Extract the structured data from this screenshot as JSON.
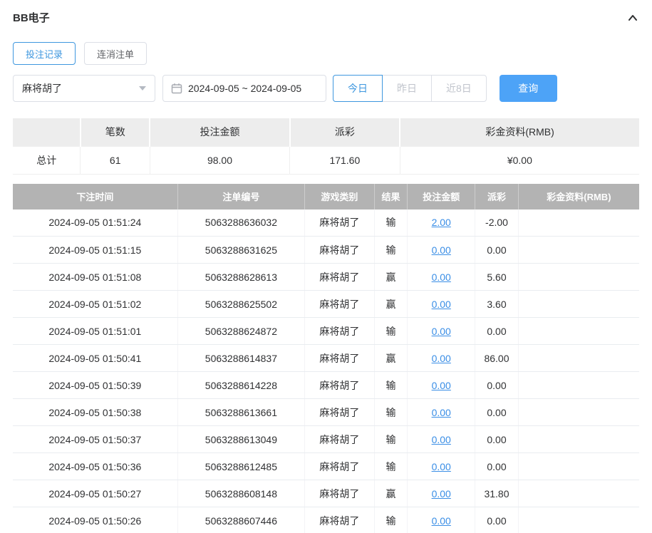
{
  "header": {
    "title": "BB电子"
  },
  "tabs": [
    {
      "label": "投注记录",
      "active": true
    },
    {
      "label": "连消注单",
      "active": false
    }
  ],
  "filters": {
    "game": "麻将胡了",
    "date_range": "2024-09-05 ~ 2024-09-05",
    "quick": [
      "今日",
      "昨日",
      "近8日"
    ],
    "quick_active": "今日",
    "search": "查询"
  },
  "summary": {
    "headers": [
      "笔数",
      "投注金额",
      "派彩",
      "彩金资料(RMB)"
    ],
    "row_label": "总计",
    "count": "61",
    "bet_amount": "98.00",
    "payout": "171.60",
    "bonus": "¥0.00"
  },
  "table": {
    "headers": [
      "下注时间",
      "注单编号",
      "游戏类别",
      "结果",
      "投注金额",
      "派彩",
      "彩金资料(RMB)"
    ],
    "rows": [
      {
        "time": "2024-09-05 01:51:24",
        "id": "5063288636032",
        "game": "麻将胡了",
        "result": "输",
        "bet": "2.00",
        "payout": "-2.00",
        "bonus": ""
      },
      {
        "time": "2024-09-05 01:51:15",
        "id": "5063288631625",
        "game": "麻将胡了",
        "result": "输",
        "bet": "0.00",
        "payout": "0.00",
        "bonus": ""
      },
      {
        "time": "2024-09-05 01:51:08",
        "id": "5063288628613",
        "game": "麻将胡了",
        "result": "赢",
        "bet": "0.00",
        "payout": "5.60",
        "bonus": ""
      },
      {
        "time": "2024-09-05 01:51:02",
        "id": "5063288625502",
        "game": "麻将胡了",
        "result": "赢",
        "bet": "0.00",
        "payout": "3.60",
        "bonus": ""
      },
      {
        "time": "2024-09-05 01:51:01",
        "id": "5063288624872",
        "game": "麻将胡了",
        "result": "输",
        "bet": "0.00",
        "payout": "0.00",
        "bonus": ""
      },
      {
        "time": "2024-09-05 01:50:41",
        "id": "5063288614837",
        "game": "麻将胡了",
        "result": "赢",
        "bet": "0.00",
        "payout": "86.00",
        "bonus": ""
      },
      {
        "time": "2024-09-05 01:50:39",
        "id": "5063288614228",
        "game": "麻将胡了",
        "result": "输",
        "bet": "0.00",
        "payout": "0.00",
        "bonus": ""
      },
      {
        "time": "2024-09-05 01:50:38",
        "id": "5063288613661",
        "game": "麻将胡了",
        "result": "输",
        "bet": "0.00",
        "payout": "0.00",
        "bonus": ""
      },
      {
        "time": "2024-09-05 01:50:37",
        "id": "5063288613049",
        "game": "麻将胡了",
        "result": "输",
        "bet": "0.00",
        "payout": "0.00",
        "bonus": ""
      },
      {
        "time": "2024-09-05 01:50:36",
        "id": "5063288612485",
        "game": "麻将胡了",
        "result": "输",
        "bet": "0.00",
        "payout": "0.00",
        "bonus": ""
      },
      {
        "time": "2024-09-05 01:50:27",
        "id": "5063288608148",
        "game": "麻将胡了",
        "result": "赢",
        "bet": "0.00",
        "payout": "31.80",
        "bonus": ""
      },
      {
        "time": "2024-09-05 01:50:26",
        "id": "5063288607446",
        "game": "麻将胡了",
        "result": "输",
        "bet": "0.00",
        "payout": "0.00",
        "bonus": ""
      }
    ]
  },
  "colors": {
    "accent": "#3e97df",
    "link": "#3a8ee6",
    "negative": "#f0544c",
    "search_button": "#4da3f7",
    "table_header_bg": "#b3b3b3",
    "summary_header_bg": "#ededed"
  }
}
